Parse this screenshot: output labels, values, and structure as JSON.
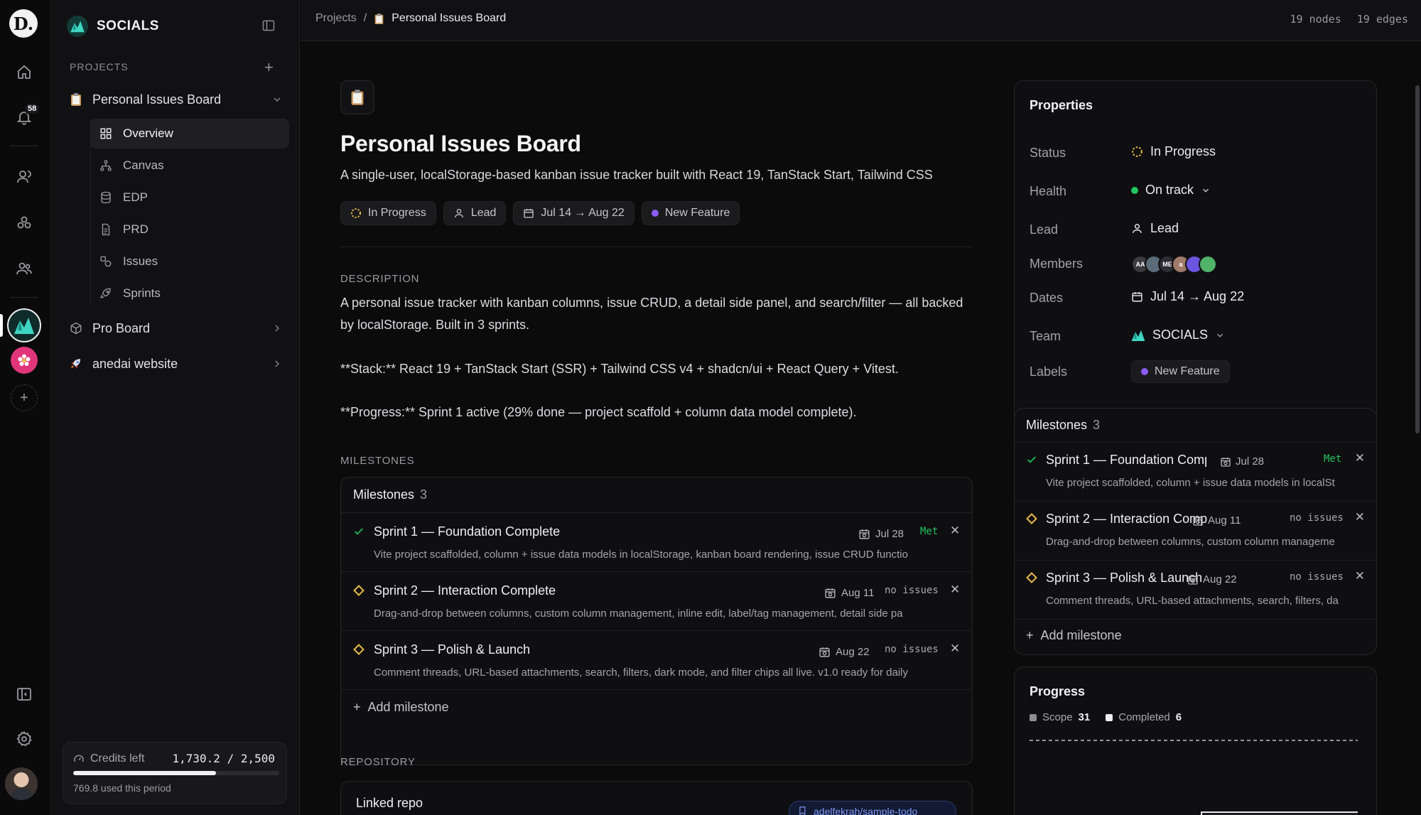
{
  "rail": {
    "logo": "D.",
    "notifications_badge": "58"
  },
  "sidebar": {
    "team_name": "SOCIALS",
    "section_label": "PROJECTS",
    "projects": [
      {
        "label": "Personal Issues Board"
      },
      {
        "label": "Pro Board"
      },
      {
        "label": "anedai website"
      }
    ],
    "subnav": [
      {
        "label": "Overview"
      },
      {
        "label": "Canvas"
      },
      {
        "label": "EDP"
      },
      {
        "label": "PRD"
      },
      {
        "label": "Issues"
      },
      {
        "label": "Sprints"
      }
    ],
    "credits": {
      "label": "Credits left",
      "value": "1,730.2 / 2,500",
      "used_text": "769.8 used this period",
      "remaining_fraction": 0.692
    }
  },
  "topbar": {
    "crumb_root": "Projects",
    "crumb_sep": "/",
    "crumb_current": "Personal Issues Board",
    "nodes": "19 nodes",
    "edges": "19 edges"
  },
  "project": {
    "title": "Personal Issues Board",
    "summary": "A single-user, localStorage-based kanban issue tracker built with React 19, TanStack Start, Tailwind CSS",
    "chips": {
      "status": "In Progress",
      "lead": "Lead",
      "dates": "Jul 14 → Aug 22",
      "label": "New Feature"
    },
    "description_label": "DESCRIPTION",
    "description": [
      "A personal issue tracker with kanban columns, issue CRUD, a detail side panel, and search/filter — all backed by localStorage. Built in 3 sprints.",
      "**Stack:** React 19 + TanStack Start (SSR) + Tailwind CSS v4 + shadcn/ui + React Query + Vitest.",
      "**Progress:** Sprint 1 active (29% done — project scaffold + column data model complete)."
    ],
    "milestones_label": "MILESTONES",
    "repository_label": "REPOSITORY",
    "repo_title": "Linked repo",
    "repo_name": "adelfekrah/sample-todo"
  },
  "milestones": {
    "title": "Milestones",
    "count": "3",
    "add_label": "Add milestone",
    "items": [
      {
        "name": "Sprint 1 — Foundation Complete",
        "short_name": "Sprint 1 — Foundation Complete",
        "date": "Jul 28",
        "status": "Met",
        "desc": "Vite project scaffolded, column + issue data models in localStorage, kanban board rendering, issue CRUD functio",
        "short_desc": "Vite project scaffolded, column + issue data models in localSt"
      },
      {
        "name": "Sprint 2 — Interaction Complete",
        "short_name": "Sprint 2 — Interaction Comp",
        "date": "Aug 11",
        "status": "no issues",
        "desc": "Drag-and-drop between columns, custom column management, inline edit, label/tag management, detail side pa",
        "short_desc": "Drag-and-drop between columns, custom column manageme"
      },
      {
        "name": "Sprint 3 — Polish & Launch",
        "short_name": "Sprint 3 — Polish & Launch",
        "date": "Aug 22",
        "status": "no issues",
        "desc": "Comment threads, URL-based attachments, search, filters, dark mode, and filter chips all live. v1.0 ready for daily",
        "short_desc": "Comment threads, URL-based attachments, search, filters, da"
      }
    ]
  },
  "properties": {
    "title": "Properties",
    "rows": {
      "status": {
        "key": "Status",
        "value": "In Progress"
      },
      "health": {
        "key": "Health",
        "value": "On track"
      },
      "lead": {
        "key": "Lead",
        "value": "Lead"
      },
      "members": {
        "key": "Members",
        "initials": [
          "AA",
          "ME",
          "a"
        ]
      },
      "dates": {
        "key": "Dates",
        "value": "Jul 14 → Aug 22"
      },
      "team": {
        "key": "Team",
        "value": "SOCIALS"
      },
      "labels": {
        "key": "Labels",
        "value": "New Feature"
      }
    }
  },
  "progress": {
    "title": "Progress",
    "scope_label": "Scope",
    "scope_value": "31",
    "completed_label": "Completed",
    "completed_value": "6"
  },
  "colors": {
    "accent_status": "#e9b949",
    "health_green": "#22c55e",
    "label_purple": "#8b5cf6",
    "met_green": "#22c55e",
    "pending_yellow": "#e9b949",
    "team_teal": "#2ec4b6"
  },
  "icons": {
    "rail": [
      "home-icon",
      "bell-icon",
      "users-icon",
      "network-icon",
      "people-icon",
      "sidebar-toggle-icon",
      "gear-icon"
    ],
    "subnav": [
      "grid-icon",
      "sitemap-icon",
      "database-icon",
      "document-icon",
      "shapes-icon",
      "rocket-icon"
    ]
  }
}
